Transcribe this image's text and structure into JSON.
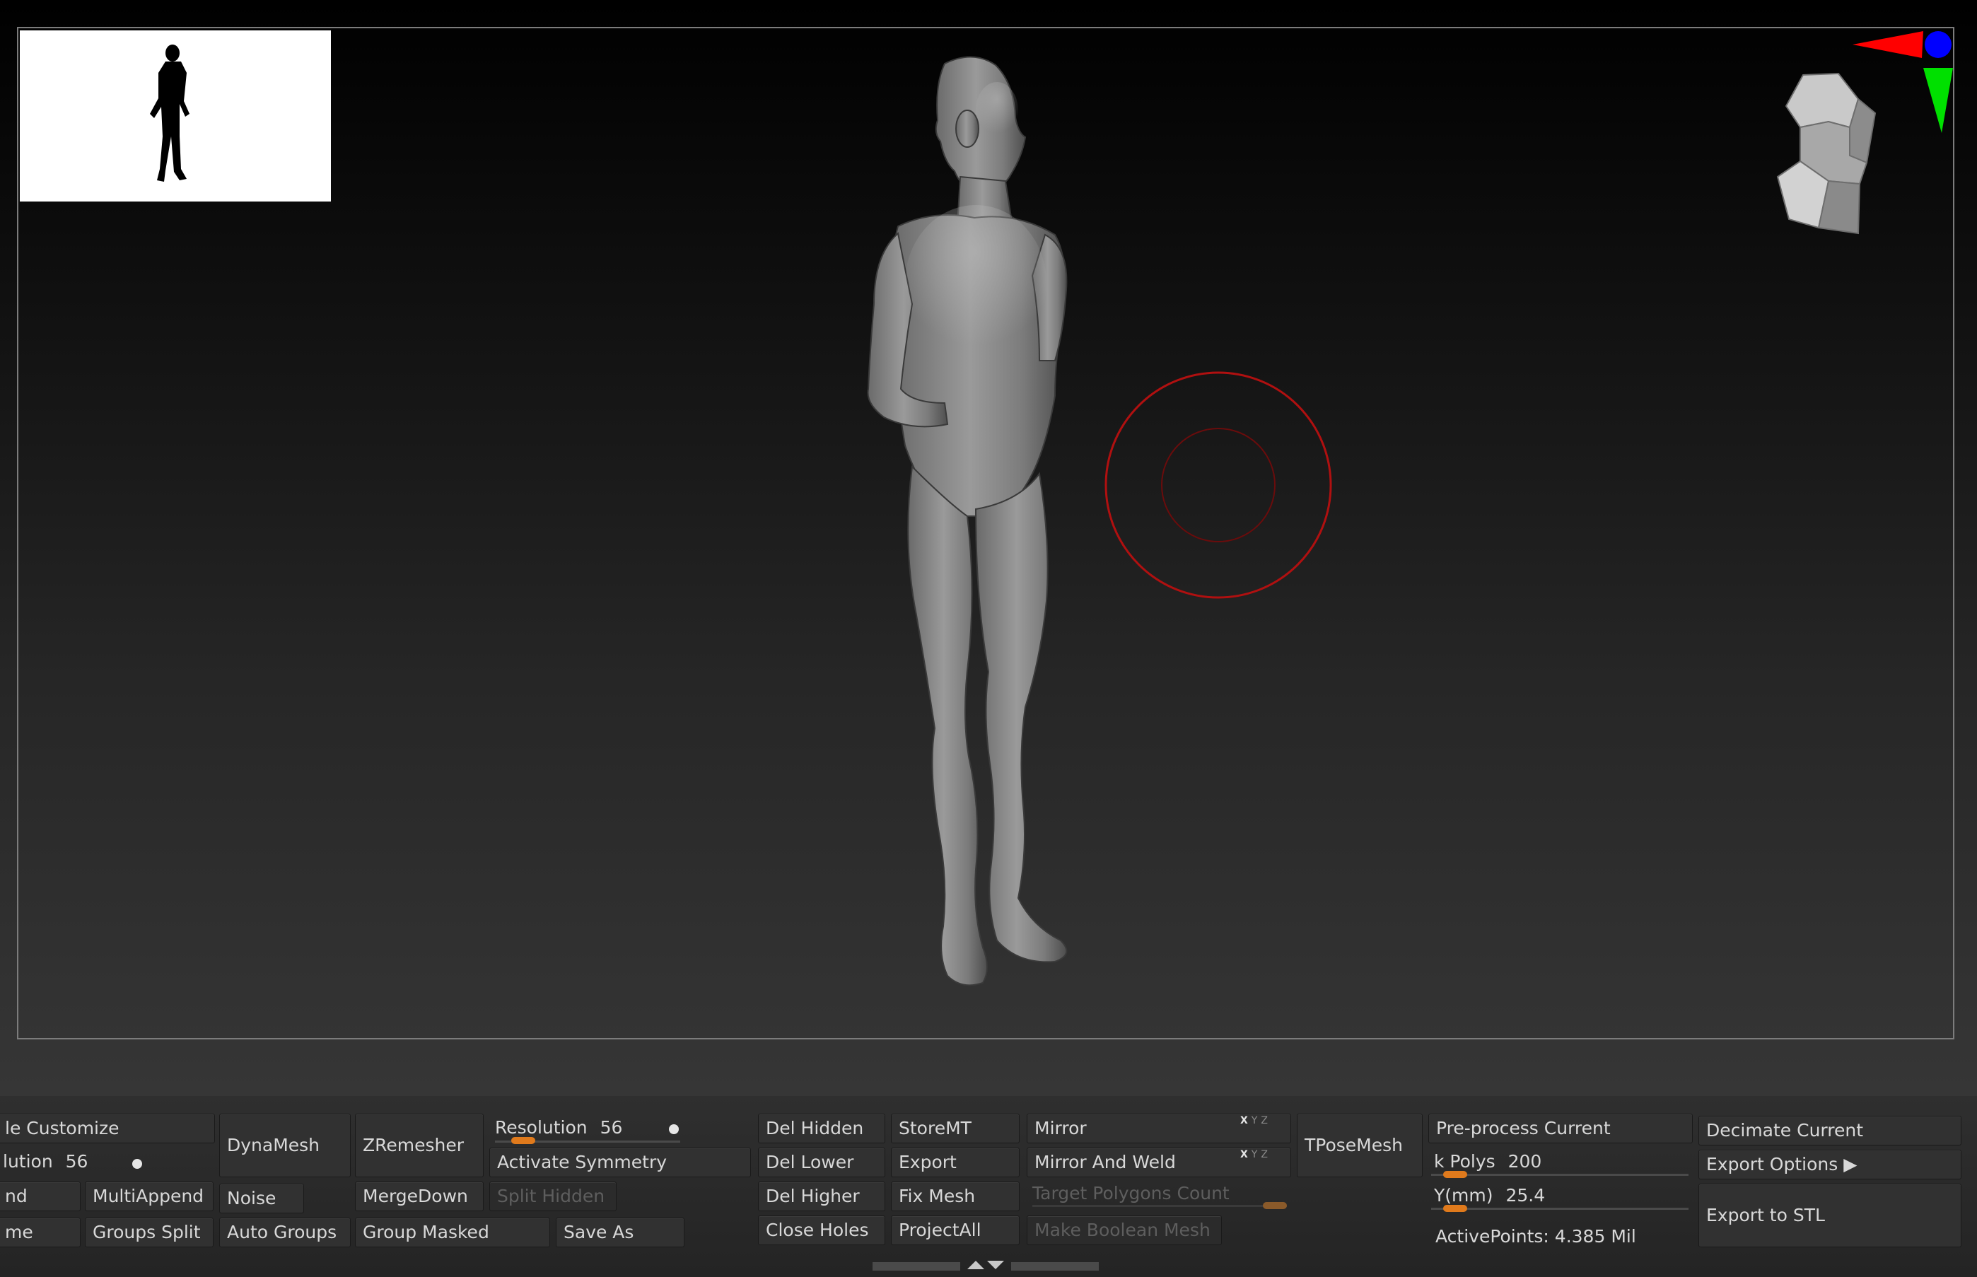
{
  "panel": {
    "col1": {
      "customize_label": "le Customize",
      "resolution_label": "lution",
      "resolution_value": "56",
      "append_label": "nd",
      "rename_label": "me"
    },
    "col2": {
      "multi_append_label": "MultiAppend",
      "groups_split_label": "Groups Split"
    },
    "col3": {
      "dynamesh_label": "DynaMesh",
      "noise_label": "Noise",
      "auto_groups_label": "Auto Groups"
    },
    "col4": {
      "zremesher_label": "ZRemesher",
      "merge_down_label": "MergeDown",
      "group_masked_label": "Group Masked"
    },
    "col5": {
      "resolution_label": "Resolution",
      "resolution_value": "56",
      "activate_symmetry_label": "Activate Symmetry",
      "split_hidden_label": "Split Hidden",
      "save_as_label": "Save As"
    },
    "col6": {
      "del_hidden_label": "Del Hidden",
      "del_lower_label": "Del Lower",
      "del_higher_label": "Del Higher",
      "close_holes_label": "Close Holes"
    },
    "col7": {
      "store_mt_label": "StoreMT",
      "export_label": "Export",
      "fix_mesh_label": "Fix Mesh",
      "project_all_label": "ProjectAll"
    },
    "col8": {
      "mirror_label": "Mirror",
      "mirror_and_weld_label": "Mirror And Weld",
      "axis_letters": "X Y Z",
      "target_polygons_label": "Target Polygons Count",
      "make_boolean_label": "Make Boolean Mesh"
    },
    "col9": {
      "tpose_label": "TPoseMesh"
    },
    "col10": {
      "preprocess_label": "Pre-process Current",
      "k_polys_label": "k Polys",
      "k_polys_value": "200",
      "y_mm_label": "Y(mm)",
      "y_mm_value": "25.4",
      "active_points": "ActivePoints: 4.385 Mil"
    },
    "col11": {
      "decimate_label": "Decimate Current",
      "export_options_label": "Export Options ▶",
      "export_stl_label": "Export to STL"
    }
  },
  "sliders": {
    "resolution_left_fraction": 0.0,
    "resolution_fraction": 0.1,
    "target_polygons_fraction": 1.0,
    "k_polys_fraction": 0.05,
    "y_mm_fraction": 0.05
  },
  "colors": {
    "slider_accent": "#e07a1c",
    "brush_cursor": "#b01010",
    "gizmo_x": "#ff0000",
    "gizmo_y": "#00e000",
    "gizmo_z": "#0000ff"
  },
  "icons": [
    "navigation-preview",
    "human-figure-model",
    "brush-cursor-icon",
    "orientation-gizmo-icon",
    "scroll-handle-icon"
  ]
}
